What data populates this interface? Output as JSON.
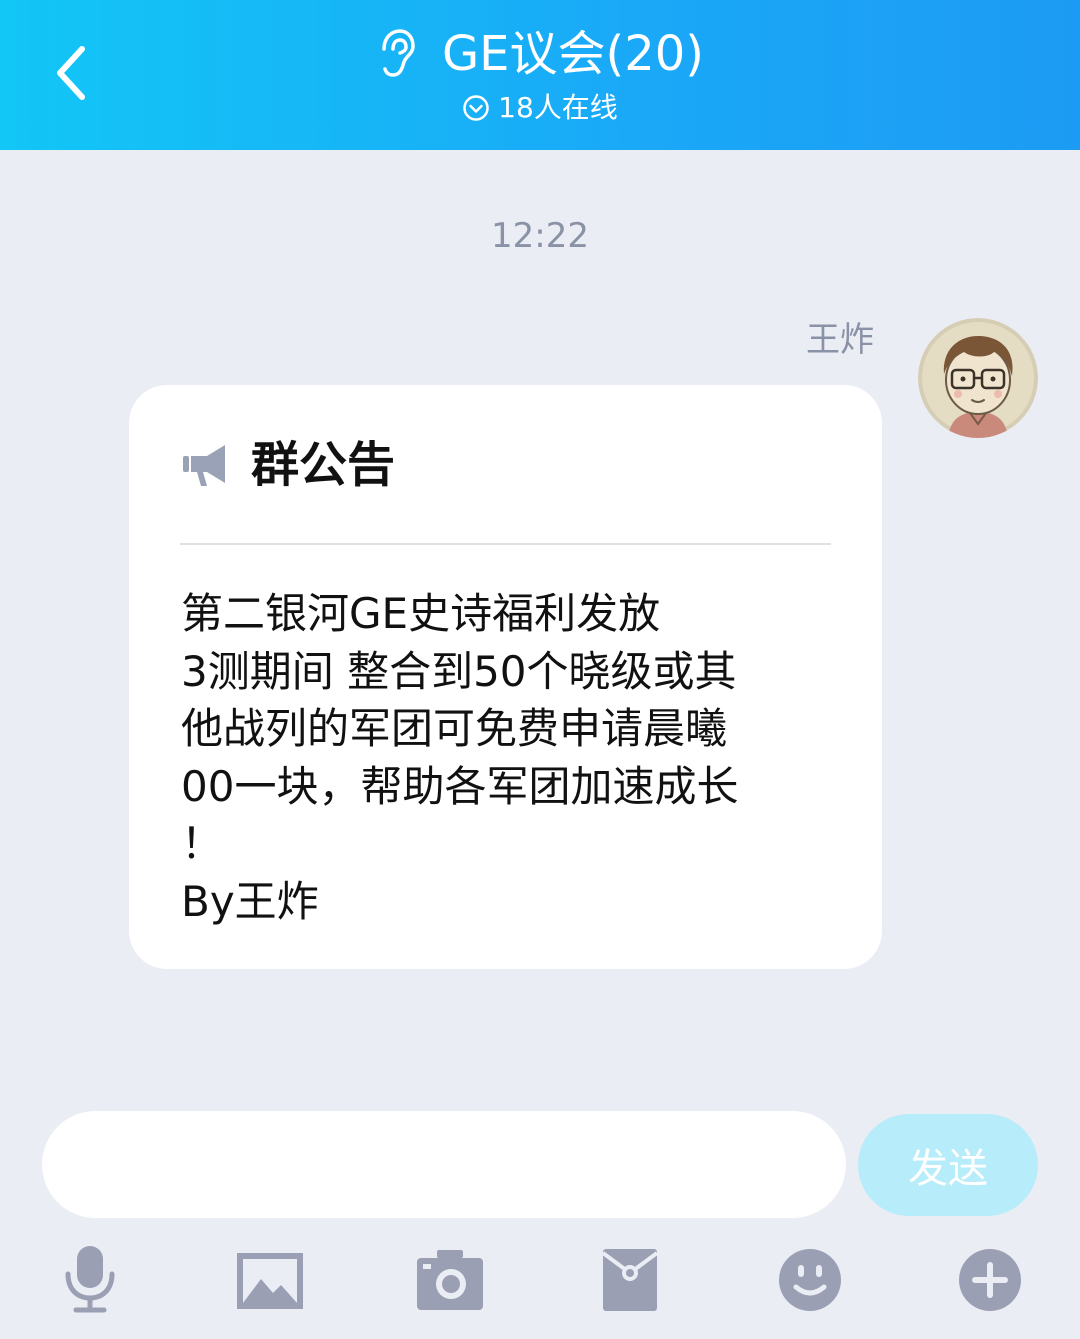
{
  "header": {
    "title": "GE议会(20)",
    "subtitle": "18人在线",
    "back_icon": "chevron-left-icon",
    "mode_icon": "ear-icon",
    "status_icon": "online-check-icon"
  },
  "chat": {
    "timestamp": "12:22",
    "message": {
      "sender": "王炸",
      "avatar_icon": "avatar-cartoon-glasses",
      "notice": {
        "icon": "megaphone-icon",
        "title": "群公告",
        "lines": [
          "第二银河GE史诗福利发放",
          "3测期间 整合到50个晓级或其",
          "他战列的军团可免费申请晨曦",
          "00一块，帮助各军团加速成长",
          "！",
          "By王炸"
        ]
      }
    }
  },
  "input": {
    "value": "",
    "placeholder": "",
    "send_label": "发送"
  },
  "toolbar": {
    "items": [
      "microphone-icon",
      "image-icon",
      "camera-icon",
      "red-packet-icon",
      "emoji-icon",
      "plus-icon"
    ]
  },
  "colors": {
    "header_start": "#12c6f6",
    "header_end": "#1d9bf4",
    "background": "#ebedf5",
    "send_button": "#b7ecfb",
    "icon_gray": "#9a9fb3"
  }
}
